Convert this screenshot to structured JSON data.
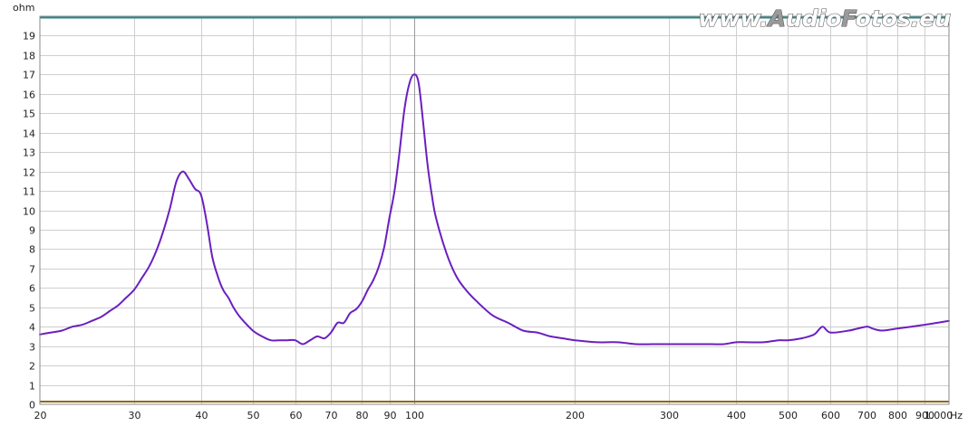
{
  "watermark": {
    "prefix": "www.",
    "a_initial": "A",
    "a_rest": "udio",
    "f_initial": "F",
    "f_rest": "otos.eu"
  },
  "colors": {
    "curve": "#6a1fbf",
    "grid": "#cfcfcf",
    "grid_major": "#9a9a9a",
    "baseline": "#8a6a1a",
    "topline": "#2a8a8a",
    "watermark_fill": "#ffffff",
    "watermark_stroke": "#555555",
    "watermark_accent": "#9a9a9a"
  },
  "chart_data": {
    "type": "line",
    "title": "",
    "xlabel": "",
    "ylabel": "",
    "x_unit": "Hz",
    "y_unit": "ohm",
    "x_scale": "log",
    "xlim": [
      20,
      1000
    ],
    "ylim": [
      0,
      20
    ],
    "grid": true,
    "y_ticks": [
      0,
      1,
      2,
      3,
      4,
      5,
      6,
      7,
      8,
      9,
      10,
      11,
      12,
      13,
      14,
      15,
      16,
      17,
      18,
      19
    ],
    "x_ticks": [
      {
        "value": 20,
        "label": "20"
      },
      {
        "value": 30,
        "label": "30"
      },
      {
        "value": 40,
        "label": "40"
      },
      {
        "value": 50,
        "label": "50"
      },
      {
        "value": 60,
        "label": "60"
      },
      {
        "value": 70,
        "label": "70"
      },
      {
        "value": 80,
        "label": "80"
      },
      {
        "value": 90,
        "label": "90"
      },
      {
        "value": 100,
        "label": "100"
      },
      {
        "value": 200,
        "label": "200"
      },
      {
        "value": 300,
        "label": "300"
      },
      {
        "value": 400,
        "label": "400"
      },
      {
        "value": 500,
        "label": "500"
      },
      {
        "value": 600,
        "label": "600"
      },
      {
        "value": 700,
        "label": "700"
      },
      {
        "value": 800,
        "label": "800"
      },
      {
        "value": 900,
        "label": "900"
      },
      {
        "value": 1000,
        "label": "1.000"
      }
    ],
    "series": [
      {
        "x": [
          20,
          21,
          22,
          23,
          24,
          25,
          26,
          27,
          28,
          29,
          30,
          31,
          32,
          33,
          34,
          35,
          36,
          37,
          38,
          39,
          40,
          41,
          42,
          43,
          44,
          45,
          46,
          47,
          48,
          50,
          52,
          54,
          56,
          58,
          60,
          62,
          64,
          66,
          68,
          70,
          72,
          74,
          76,
          78,
          80,
          82,
          84,
          86,
          88,
          90,
          92,
          94,
          96,
          98,
          100,
          102,
          104,
          106,
          108,
          110,
          115,
          120,
          125,
          130,
          140,
          150,
          160,
          170,
          180,
          190,
          200,
          220,
          240,
          260,
          280,
          300,
          320,
          340,
          360,
          380,
          400,
          420,
          450,
          480,
          500,
          530,
          560,
          580,
          600,
          650,
          700,
          720,
          750,
          800,
          850,
          900,
          950,
          1000
        ],
        "y": [
          3.6,
          3.7,
          3.8,
          4.0,
          4.1,
          4.3,
          4.5,
          4.8,
          5.1,
          5.5,
          5.9,
          6.5,
          7.1,
          7.9,
          8.9,
          10.1,
          11.5,
          12.0,
          11.6,
          11.1,
          10.8,
          9.4,
          7.6,
          6.6,
          5.9,
          5.5,
          5.0,
          4.6,
          4.3,
          3.8,
          3.5,
          3.3,
          3.3,
          3.3,
          3.3,
          3.1,
          3.3,
          3.5,
          3.4,
          3.7,
          4.2,
          4.2,
          4.7,
          4.9,
          5.3,
          5.9,
          6.4,
          7.1,
          8.1,
          9.6,
          11.0,
          13.0,
          15.2,
          16.5,
          17.0,
          16.6,
          14.6,
          12.4,
          10.8,
          9.6,
          7.8,
          6.6,
          5.9,
          5.4,
          4.6,
          4.2,
          3.8,
          3.7,
          3.5,
          3.4,
          3.3,
          3.2,
          3.2,
          3.1,
          3.1,
          3.1,
          3.1,
          3.1,
          3.1,
          3.1,
          3.2,
          3.2,
          3.2,
          3.3,
          3.3,
          3.4,
          3.6,
          4.0,
          3.7,
          3.8,
          4.0,
          3.9,
          3.8,
          3.9,
          4.0,
          4.1,
          4.2,
          4.3
        ]
      }
    ]
  }
}
